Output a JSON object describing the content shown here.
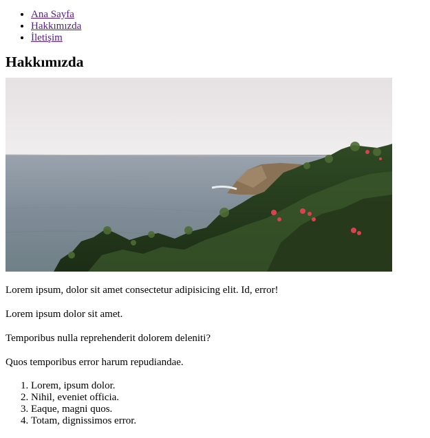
{
  "nav": {
    "items": [
      {
        "label": "Ana Sayfa"
      },
      {
        "label": "Hakkımızda"
      },
      {
        "label": "İletişim"
      }
    ]
  },
  "page_title": "Hakkımızda",
  "paragraphs": [
    "Lorem ipsum, dolor sit amet consectetur adipisicing elit. Id, error!",
    "Lorem ipsum dolor sit amet.",
    "Temporibus nulla reprehenderit dolorem deleniti?",
    "Quos temporibus error harum repudiandae."
  ],
  "list_items": [
    "Lorem, ipsum dolor.",
    "Nihil, eveniet officia.",
    "Eaque, magni quos.",
    "Totam, dignissimos error."
  ],
  "colors": {
    "link_visited": "#551a8b"
  }
}
